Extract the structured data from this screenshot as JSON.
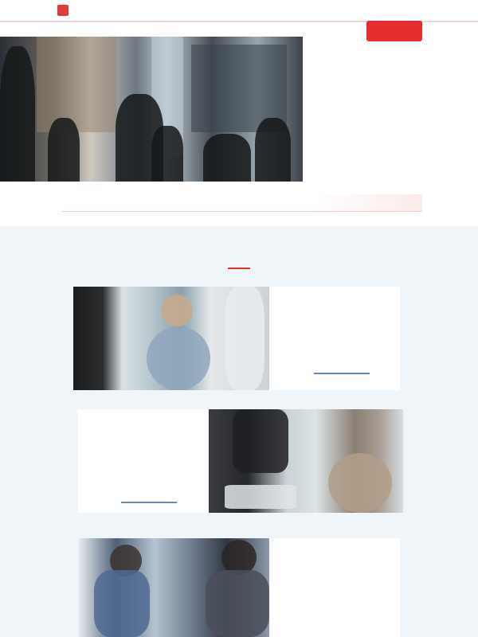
{
  "header": {
    "logo_text": "",
    "right_text": ""
  },
  "nav": {
    "items": [
      "",
      "",
      "",
      "",
      "",
      "",
      "",
      ""
    ],
    "contact_label": ""
  },
  "hero": {
    "line1": "",
    "line2": "",
    "banner": ""
  },
  "services": {
    "title": "",
    "cards": [
      {
        "title_line1": "",
        "title_line2": "",
        "link": "",
        "more": ""
      },
      {
        "title_line1": "",
        "title_line2": "",
        "link": "",
        "more": ""
      },
      {
        "title_line1": "",
        "title_line2": "",
        "link": "",
        "more": ""
      }
    ]
  },
  "colors": {
    "accent": "#e62e2e",
    "section_bg": "#f0f5fa",
    "link_blue": "#6a86c0"
  }
}
